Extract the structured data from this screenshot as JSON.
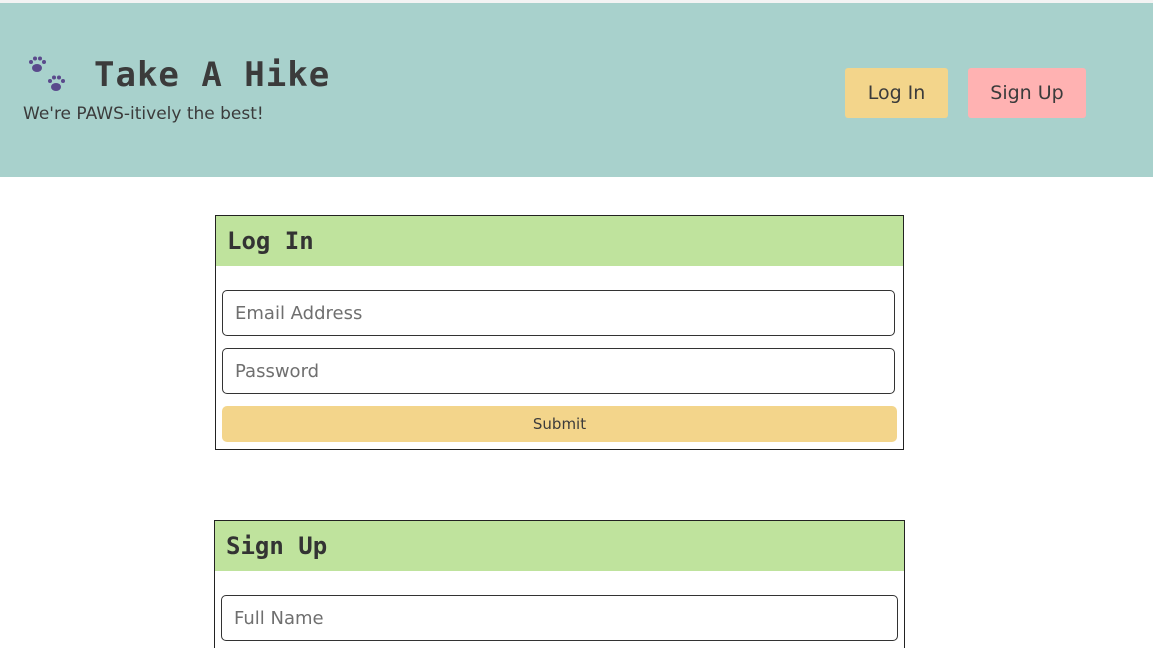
{
  "header": {
    "title": "Take A Hike",
    "tagline": "We're PAWS-itively the best!",
    "logo_icon": "paw-prints-icon",
    "login_label": "Log In",
    "signup_label": "Sign Up"
  },
  "login": {
    "heading": "Log In",
    "email_placeholder": "Email Address",
    "password_placeholder": "Password",
    "submit_label": "Submit"
  },
  "signup": {
    "heading": "Sign Up",
    "name_placeholder": "Full Name"
  },
  "colors": {
    "header_bg": "#a8d1cc",
    "card_header_bg": "#bfe39d",
    "login_button_bg": "#f3d58b",
    "signup_button_bg": "#ffb2b2",
    "paw_icon": "#5a4a8c"
  }
}
